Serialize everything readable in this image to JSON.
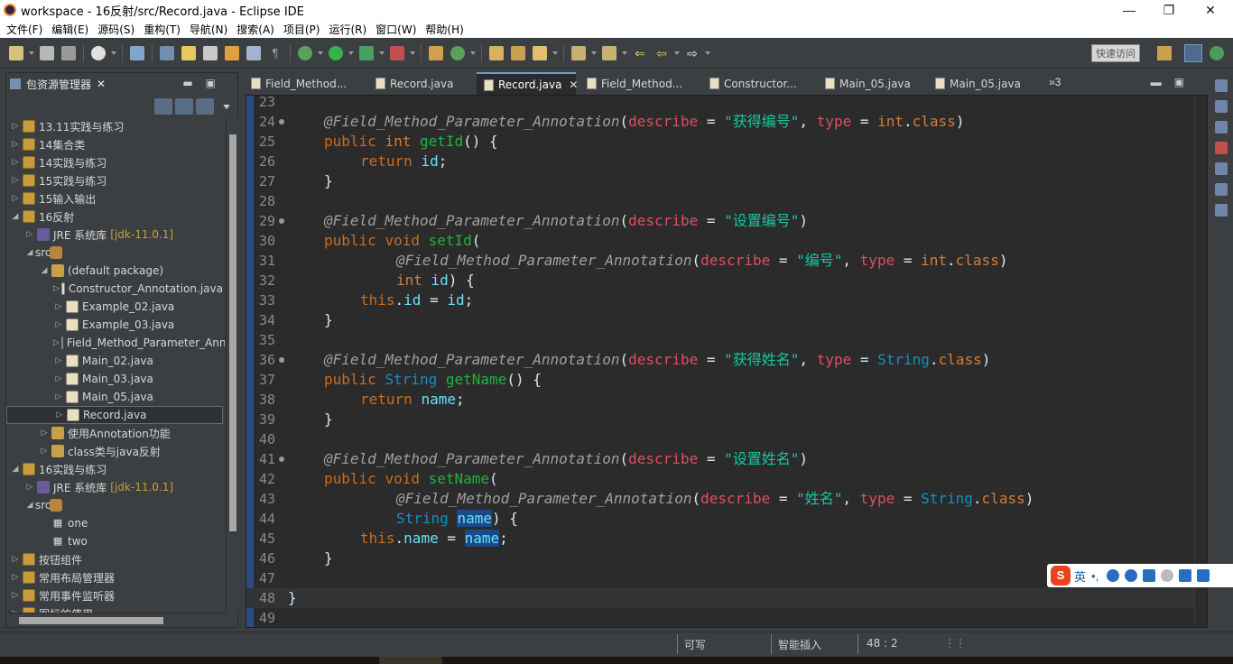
{
  "window": {
    "title": "workspace - 16反射/src/Record.java - Eclipse IDE",
    "controls": {
      "minimize": "—",
      "restore": "❐",
      "close": "✕"
    }
  },
  "menu": [
    "文件(F)",
    "编辑(E)",
    "源码(S)",
    "重构(T)",
    "导航(N)",
    "搜索(A)",
    "项目(P)",
    "运行(R)",
    "窗口(W)",
    "帮助(H)"
  ],
  "toolbar": {
    "quick_access": "快速访问"
  },
  "package_explorer": {
    "title": "包资源管理器",
    "close": "✕",
    "items": [
      {
        "label": "13.11实践与练习",
        "arrow": "▷",
        "icon": "project-icon"
      },
      {
        "label": "14集合类",
        "arrow": "▷",
        "icon": "project-icon"
      },
      {
        "label": "14实践与练习",
        "arrow": "▷",
        "icon": "project-icon"
      },
      {
        "label": "15实践与练习",
        "arrow": "▷",
        "icon": "project-icon"
      },
      {
        "label": "15输入输出",
        "arrow": "▷",
        "icon": "project-icon"
      },
      {
        "label": "16反射",
        "arrow": "◢",
        "icon": "project-icon"
      },
      {
        "label": "JRE 系统库",
        "suffix": "[jdk-11.0.1]",
        "arrow": "▷",
        "icon": "library-icon"
      },
      {
        "label": "src",
        "arrow": "◢",
        "icon": "source-folder-icon"
      },
      {
        "label": "(default package)",
        "arrow": "◢",
        "icon": "package-icon"
      },
      {
        "label": "Constructor_Annotation.java",
        "arrow": "▷",
        "icon": "java-file-icon"
      },
      {
        "label": "Example_02.java",
        "arrow": "▷",
        "icon": "java-file-icon"
      },
      {
        "label": "Example_03.java",
        "arrow": "▷",
        "icon": "java-file-icon"
      },
      {
        "label": "Field_Method_Parameter_Annotation.java",
        "arrow": "▷",
        "icon": "java-file-icon"
      },
      {
        "label": "Main_02.java",
        "arrow": "▷",
        "icon": "java-file-icon"
      },
      {
        "label": "Main_03.java",
        "arrow": "▷",
        "icon": "java-file-icon"
      },
      {
        "label": "Main_05.java",
        "arrow": "▷",
        "icon": "java-file-icon"
      },
      {
        "label": "Record.java",
        "arrow": "▷",
        "icon": "java-file-icon",
        "selected": true
      },
      {
        "label": "使用Annotation功能",
        "arrow": "▷",
        "icon": "package-icon"
      },
      {
        "label": "class类与java反射",
        "arrow": "▷",
        "icon": "package-icon"
      },
      {
        "label": "16实践与练习",
        "arrow": "◢",
        "icon": "project-icon"
      },
      {
        "label": "JRE 系统库",
        "suffix": "[jdk-11.0.1]",
        "arrow": "▷",
        "icon": "library-icon"
      },
      {
        "label": "src",
        "arrow": "◢",
        "icon": "source-folder-icon"
      },
      {
        "label": "one",
        "arrow": "",
        "icon": "package-icon"
      },
      {
        "label": "two",
        "arrow": "",
        "icon": "package-icon"
      },
      {
        "label": "按钮组件",
        "arrow": "▷",
        "icon": "project-icon"
      },
      {
        "label": "常用布局管理器",
        "arrow": "▷",
        "icon": "project-icon"
      },
      {
        "label": "常用事件监听器",
        "arrow": "▷",
        "icon": "project-icon"
      },
      {
        "label": "图标的使用",
        "arrow": "▷",
        "icon": "project-icon"
      }
    ]
  },
  "editor_tabs": [
    {
      "label": "Field_Method..."
    },
    {
      "label": "Record.java"
    },
    {
      "label": "Record.java",
      "active": true,
      "close": "✕"
    },
    {
      "label": "Field_Method..."
    },
    {
      "label": "Constructor..."
    },
    {
      "label": "Main_05.java"
    },
    {
      "label": "Main_05.java"
    }
  ],
  "overflow_tabs": "»3",
  "code": [
    {
      "n": "23",
      "t": ""
    },
    {
      "n": "24",
      "t": "@F",
      "fold": true
    },
    {
      "n": "25",
      "t": "public int getId() {"
    },
    {
      "n": "26",
      "t": "    return id;"
    },
    {
      "n": "27",
      "t": "}"
    },
    {
      "n": "28",
      "t": ""
    },
    {
      "n": "29",
      "t": "@F2",
      "fold": true
    },
    {
      "n": "30",
      "t": "public void setId("
    },
    {
      "n": "31",
      "t": "@F3"
    },
    {
      "n": "32",
      "t": "int id) {"
    },
    {
      "n": "33",
      "t": "this.id = id;"
    },
    {
      "n": "34",
      "t": "}"
    },
    {
      "n": "35",
      "t": ""
    },
    {
      "n": "36",
      "t": "@F4",
      "fold": true
    },
    {
      "n": "37",
      "t": "public String getName() {"
    },
    {
      "n": "38",
      "t": "return name;"
    },
    {
      "n": "39",
      "t": "}"
    },
    {
      "n": "40",
      "t": ""
    },
    {
      "n": "41",
      "t": "@F5",
      "fold": true
    },
    {
      "n": "42",
      "t": "public void setName("
    },
    {
      "n": "43",
      "t": "@F6"
    },
    {
      "n": "44",
      "t": "String name) {"
    },
    {
      "n": "45",
      "t": "this.name = name;"
    },
    {
      "n": "46",
      "t": "}"
    },
    {
      "n": "47",
      "t": ""
    },
    {
      "n": "48",
      "t": "}"
    },
    {
      "n": "49",
      "t": ""
    }
  ],
  "code_text": {
    "ann": "@Field_Method_Parameter_Annotation",
    "describe": "describe",
    "type": "type",
    "s1": "\"获得编号\"",
    "s2": "\"设置编号\"",
    "s3": "\"编号\"",
    "s4": "\"获得姓名\"",
    "s5": "\"设置姓名\"",
    "s6": "\"姓名\"",
    "int": "int",
    "class": "class",
    "String": "String",
    "public": "public",
    "void": "void",
    "return": "return",
    "this": "this",
    "getId": "getId",
    "setId": "setId",
    "getName": "getName",
    "setName": "setName",
    "id": "id",
    "name": "name"
  },
  "ime": {
    "logo": "S",
    "mode": "英",
    "extra": "•,"
  },
  "status": {
    "writable": "可写",
    "insert_mode": "智能插入",
    "position": "48 : 2"
  }
}
